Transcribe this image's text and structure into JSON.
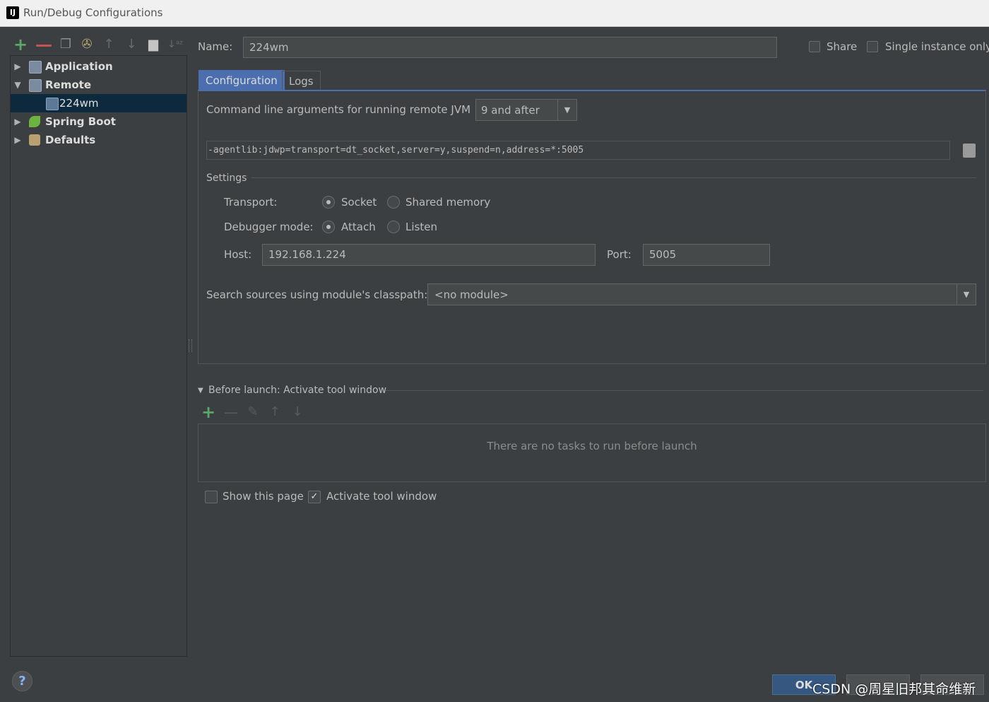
{
  "window": {
    "title": "Run/Debug Configurations",
    "app_icon_text": "IJ"
  },
  "toolbar": {
    "icons": [
      "plus-icon",
      "minus-icon",
      "copy-icon",
      "wrench-icon",
      "arrow-up-icon",
      "arrow-down-icon",
      "folder-icon",
      "sort-icon"
    ],
    "plus": "+",
    "minus": "—",
    "copy": "❐",
    "wrench": "✇",
    "up": "↑",
    "down": "↓",
    "folder": "▆",
    "sort": "↓ᵃᶻ"
  },
  "tree": {
    "items": [
      {
        "label": "Application",
        "expanded": false
      },
      {
        "label": "Remote",
        "expanded": true
      },
      {
        "label": "224wm",
        "selected": true
      },
      {
        "label": "Spring Boot",
        "expanded": false
      },
      {
        "label": "Defaults",
        "expanded": false
      }
    ]
  },
  "form": {
    "name_label": "Name:",
    "name_value": "224wm",
    "share_label": "Share",
    "single_instance_label": "Single instance only",
    "tabs": [
      "Configuration",
      "Logs"
    ],
    "cmd_label": "Command line arguments for running remote JVM",
    "jvm_version": "9 and after",
    "cmd_value": "-agentlib:jdwp=transport=dt_socket,server=y,suspend=n,address=*:5005",
    "settings_label": "Settings",
    "transport_label": "Transport:",
    "transport_options": [
      "Socket",
      "Shared memory"
    ],
    "debugger_label": "Debugger mode:",
    "debugger_options": [
      "Attach",
      "Listen"
    ],
    "host_label": "Host:",
    "host_value": "192.168.1.224",
    "port_label": "Port:",
    "port_value": "5005",
    "module_label": "Search sources using module's classpath:",
    "module_value": "<no module>"
  },
  "before_launch": {
    "title": "Before launch: Activate tool window",
    "empty_text": "There are no tasks to run before launch",
    "plus": "+",
    "minus": "—",
    "edit": "✎",
    "up": "↑",
    "down": "↓"
  },
  "footer": {
    "show_page_label": "Show this page",
    "activate_label": "Activate tool window",
    "ok_label": "OK",
    "help": "?",
    "watermark": "CSDN @周星旧邦其命维新"
  },
  "colors": {
    "background": "#3c3f41",
    "accent": "#4b6eaf",
    "selection": "#0d293e",
    "add_green": "#59a869",
    "remove_red": "#c75450"
  }
}
